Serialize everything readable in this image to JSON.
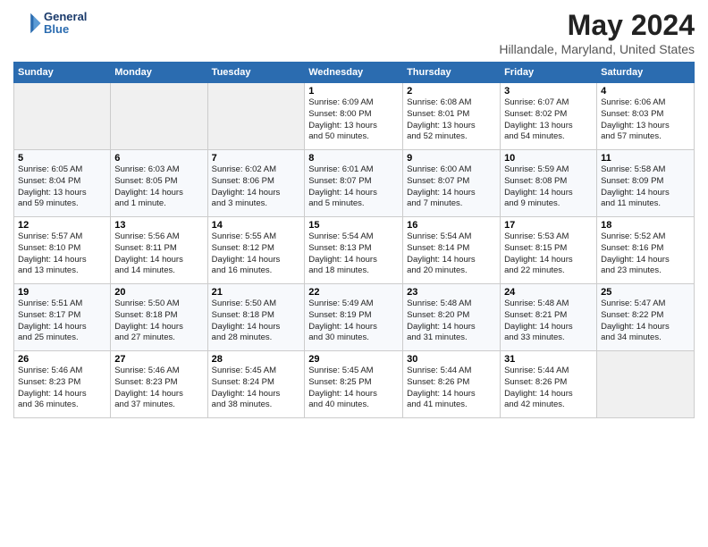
{
  "logo": {
    "line1": "General",
    "line2": "Blue"
  },
  "title": "May 2024",
  "subtitle": "Hillandale, Maryland, United States",
  "header_days": [
    "Sunday",
    "Monday",
    "Tuesday",
    "Wednesday",
    "Thursday",
    "Friday",
    "Saturday"
  ],
  "weeks": [
    [
      {
        "day": "",
        "info": ""
      },
      {
        "day": "",
        "info": ""
      },
      {
        "day": "",
        "info": ""
      },
      {
        "day": "1",
        "info": "Sunrise: 6:09 AM\nSunset: 8:00 PM\nDaylight: 13 hours\nand 50 minutes."
      },
      {
        "day": "2",
        "info": "Sunrise: 6:08 AM\nSunset: 8:01 PM\nDaylight: 13 hours\nand 52 minutes."
      },
      {
        "day": "3",
        "info": "Sunrise: 6:07 AM\nSunset: 8:02 PM\nDaylight: 13 hours\nand 54 minutes."
      },
      {
        "day": "4",
        "info": "Sunrise: 6:06 AM\nSunset: 8:03 PM\nDaylight: 13 hours\nand 57 minutes."
      }
    ],
    [
      {
        "day": "5",
        "info": "Sunrise: 6:05 AM\nSunset: 8:04 PM\nDaylight: 13 hours\nand 59 minutes."
      },
      {
        "day": "6",
        "info": "Sunrise: 6:03 AM\nSunset: 8:05 PM\nDaylight: 14 hours\nand 1 minute."
      },
      {
        "day": "7",
        "info": "Sunrise: 6:02 AM\nSunset: 8:06 PM\nDaylight: 14 hours\nand 3 minutes."
      },
      {
        "day": "8",
        "info": "Sunrise: 6:01 AM\nSunset: 8:07 PM\nDaylight: 14 hours\nand 5 minutes."
      },
      {
        "day": "9",
        "info": "Sunrise: 6:00 AM\nSunset: 8:07 PM\nDaylight: 14 hours\nand 7 minutes."
      },
      {
        "day": "10",
        "info": "Sunrise: 5:59 AM\nSunset: 8:08 PM\nDaylight: 14 hours\nand 9 minutes."
      },
      {
        "day": "11",
        "info": "Sunrise: 5:58 AM\nSunset: 8:09 PM\nDaylight: 14 hours\nand 11 minutes."
      }
    ],
    [
      {
        "day": "12",
        "info": "Sunrise: 5:57 AM\nSunset: 8:10 PM\nDaylight: 14 hours\nand 13 minutes."
      },
      {
        "day": "13",
        "info": "Sunrise: 5:56 AM\nSunset: 8:11 PM\nDaylight: 14 hours\nand 14 minutes."
      },
      {
        "day": "14",
        "info": "Sunrise: 5:55 AM\nSunset: 8:12 PM\nDaylight: 14 hours\nand 16 minutes."
      },
      {
        "day": "15",
        "info": "Sunrise: 5:54 AM\nSunset: 8:13 PM\nDaylight: 14 hours\nand 18 minutes."
      },
      {
        "day": "16",
        "info": "Sunrise: 5:54 AM\nSunset: 8:14 PM\nDaylight: 14 hours\nand 20 minutes."
      },
      {
        "day": "17",
        "info": "Sunrise: 5:53 AM\nSunset: 8:15 PM\nDaylight: 14 hours\nand 22 minutes."
      },
      {
        "day": "18",
        "info": "Sunrise: 5:52 AM\nSunset: 8:16 PM\nDaylight: 14 hours\nand 23 minutes."
      }
    ],
    [
      {
        "day": "19",
        "info": "Sunrise: 5:51 AM\nSunset: 8:17 PM\nDaylight: 14 hours\nand 25 minutes."
      },
      {
        "day": "20",
        "info": "Sunrise: 5:50 AM\nSunset: 8:18 PM\nDaylight: 14 hours\nand 27 minutes."
      },
      {
        "day": "21",
        "info": "Sunrise: 5:50 AM\nSunset: 8:18 PM\nDaylight: 14 hours\nand 28 minutes."
      },
      {
        "day": "22",
        "info": "Sunrise: 5:49 AM\nSunset: 8:19 PM\nDaylight: 14 hours\nand 30 minutes."
      },
      {
        "day": "23",
        "info": "Sunrise: 5:48 AM\nSunset: 8:20 PM\nDaylight: 14 hours\nand 31 minutes."
      },
      {
        "day": "24",
        "info": "Sunrise: 5:48 AM\nSunset: 8:21 PM\nDaylight: 14 hours\nand 33 minutes."
      },
      {
        "day": "25",
        "info": "Sunrise: 5:47 AM\nSunset: 8:22 PM\nDaylight: 14 hours\nand 34 minutes."
      }
    ],
    [
      {
        "day": "26",
        "info": "Sunrise: 5:46 AM\nSunset: 8:23 PM\nDaylight: 14 hours\nand 36 minutes."
      },
      {
        "day": "27",
        "info": "Sunrise: 5:46 AM\nSunset: 8:23 PM\nDaylight: 14 hours\nand 37 minutes."
      },
      {
        "day": "28",
        "info": "Sunrise: 5:45 AM\nSunset: 8:24 PM\nDaylight: 14 hours\nand 38 minutes."
      },
      {
        "day": "29",
        "info": "Sunrise: 5:45 AM\nSunset: 8:25 PM\nDaylight: 14 hours\nand 40 minutes."
      },
      {
        "day": "30",
        "info": "Sunrise: 5:44 AM\nSunset: 8:26 PM\nDaylight: 14 hours\nand 41 minutes."
      },
      {
        "day": "31",
        "info": "Sunrise: 5:44 AM\nSunset: 8:26 PM\nDaylight: 14 hours\nand 42 minutes."
      },
      {
        "day": "",
        "info": ""
      }
    ]
  ]
}
